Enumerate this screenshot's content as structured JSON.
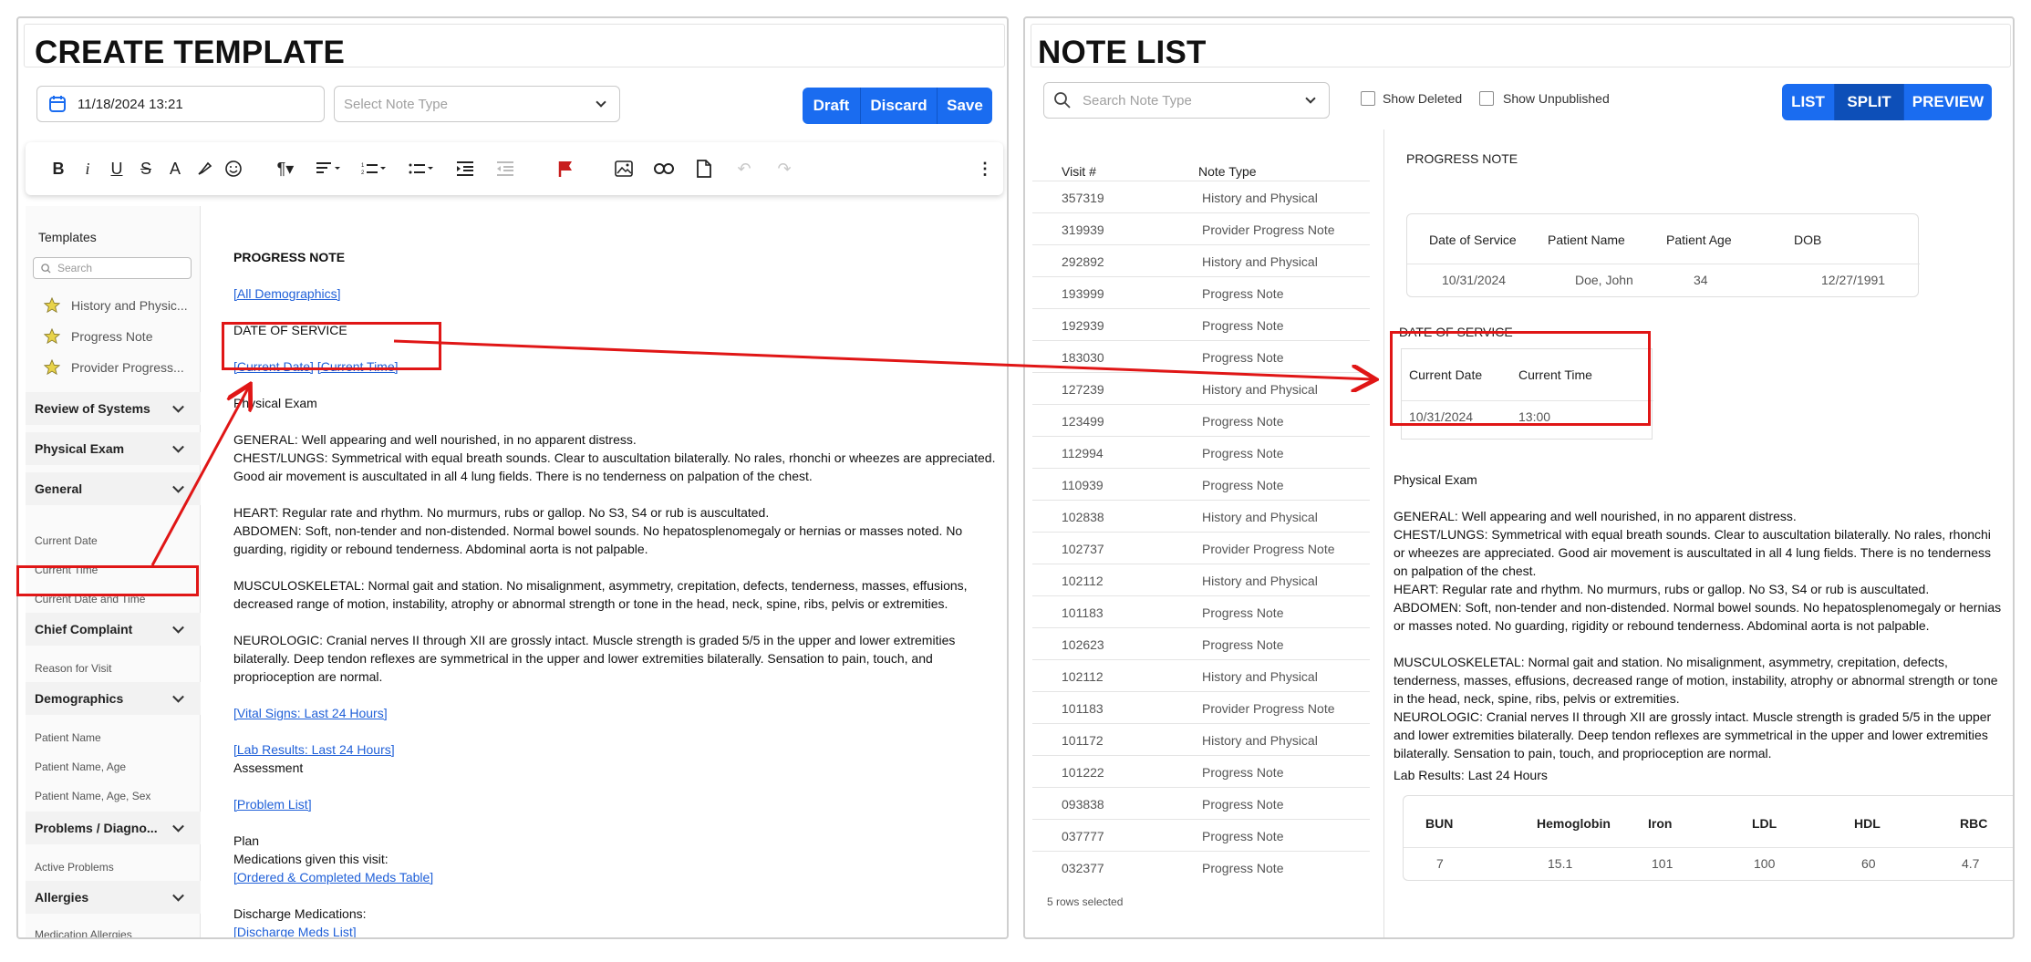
{
  "create_template": {
    "title": "CREATE TEMPLATE",
    "date_value": "11/18/2024 13:21",
    "note_type_placeholder": "Select Note Type",
    "buttons": {
      "draft": "Draft",
      "discard": "Discard",
      "save": "Save"
    },
    "toolbar_icons": [
      "bold-icon",
      "italic-icon",
      "underline-icon",
      "strikethrough-icon",
      "font-color-icon",
      "highlighter-icon",
      "emoji-icon",
      "paragraph-format-icon",
      "align-icon",
      "ordered-list-icon",
      "unordered-list-icon",
      "indent-icon",
      "outdent-icon",
      "flag-icon",
      "image-icon",
      "link-icon",
      "document-icon",
      "undo-icon",
      "redo-icon",
      "more-vertical-icon"
    ],
    "sidebar": {
      "templates_label": "Templates",
      "search_placeholder": "Search",
      "templates": [
        "History and Physic...",
        "Progress Note",
        "Provider Progress..."
      ],
      "sections": [
        {
          "label": "Review of Systems",
          "items": []
        },
        {
          "label": "Physical Exam",
          "items": []
        },
        {
          "label": "General",
          "items": [
            "Current Date",
            "Current Time",
            "Current Date and Time"
          ]
        },
        {
          "label": "Chief Complaint",
          "items": [
            "Reason for Visit"
          ]
        },
        {
          "label": "Demographics",
          "items": [
            "Patient Name",
            "Patient Name, Age",
            "Patient Name, Age, Sex"
          ]
        },
        {
          "label": "Problems / Diagno...",
          "items": [
            "Active Problems"
          ]
        },
        {
          "label": "Allergies",
          "items": [
            "Medication Allergies"
          ]
        }
      ]
    },
    "document": {
      "heading": "PROGRESS NOTE",
      "all_demographics": "[All Demographics]",
      "date_of_service": "DATE OF SERVICE",
      "current_date": "[Current Date]",
      "current_time": "[Current Time]",
      "physical_exam": "Physical Exam",
      "general": "GENERAL: Well appearing and well nourished, in no apparent distress.",
      "chest": "CHEST/LUNGS: Symmetrical with equal breath sounds. Clear to auscultation bilaterally. No rales, rhonchi or wheezes are appreciated. Good air movement is auscultated in all 4 lung fields. There is no tenderness on palpation of the chest.",
      "heart": "HEART: Regular rate and rhythm. No murmurs, rubs or gallop. No S3, S4 or rub is auscultated.",
      "abdomen": "ABDOMEN: Soft, non-tender and non-distended. Normal bowel sounds. No hepatosplenomegaly or hernias or masses noted. No guarding, rigidity or rebound tenderness. Abdominal aorta is not palpable.",
      "musculo": "MUSCULOSKELETAL: Normal gait and station. No misalignment, asymmetry, crepitation, defects, tenderness, masses, effusions, decreased range of motion, instability, atrophy or abnormal strength or tone in the head, neck, spine, ribs, pelvis or extremities.",
      "neuro": "NEUROLOGIC: Cranial nerves II through XII are grossly intact. Muscle strength is graded 5/5 in the upper and lower extremities bilaterally. Deep tendon reflexes are symmetrical in the upper and lower extremities bilaterally. Sensation to pain, touch, and proprioception are normal.",
      "vitals": "[Vital Signs: Last 24 Hours]",
      "labs": "[Lab Results: Last 24 Hours]",
      "assessment": "Assessment",
      "problem_list": "[Problem List]",
      "plan": "Plan",
      "meds_given": "Medications given this visit:",
      "meds_table": "[Ordered & Completed Meds Table]",
      "discharge": "Discharge Medications:",
      "discharge_list": "[Discharge Meds List]"
    }
  },
  "note_list": {
    "title": "NOTE LIST",
    "search_placeholder": "Search Note Type",
    "show_deleted": "Show Deleted",
    "show_unpublished": "Show Unpublished",
    "view_buttons": {
      "list": "LIST",
      "split": "SPLIT",
      "preview": "PREVIEW"
    },
    "columns": {
      "visit": "Visit #",
      "type": "Note Type"
    },
    "rows": [
      {
        "visit": "357319",
        "type": "History and Physical"
      },
      {
        "visit": "319939",
        "type": "Provider Progress Note"
      },
      {
        "visit": "292892",
        "type": "History and Physical"
      },
      {
        "visit": "193999",
        "type": "Progress Note"
      },
      {
        "visit": "192939",
        "type": "Progress Note"
      },
      {
        "visit": "183030",
        "type": "Progress Note"
      },
      {
        "visit": "127239",
        "type": "History and Physical"
      },
      {
        "visit": "123499",
        "type": "Progress Note"
      },
      {
        "visit": "112994",
        "type": "Progress Note"
      },
      {
        "visit": "110939",
        "type": "Progress Note"
      },
      {
        "visit": "102838",
        "type": "History and Physical"
      },
      {
        "visit": "102737",
        "type": "Provider Progress Note"
      },
      {
        "visit": "102112",
        "type": "History and Physical"
      },
      {
        "visit": "101183",
        "type": "Progress Note"
      },
      {
        "visit": "102623",
        "type": "Progress Note"
      },
      {
        "visit": "102112",
        "type": "History and Physical"
      },
      {
        "visit": "101183",
        "type": "Provider Progress Note"
      },
      {
        "visit": "101172",
        "type": "History and Physical"
      },
      {
        "visit": "101222",
        "type": "Progress Note"
      },
      {
        "visit": "093838",
        "type": "Progress Note"
      },
      {
        "visit": "037777",
        "type": "Progress Note"
      },
      {
        "visit": "032377",
        "type": "Progress Note"
      }
    ],
    "rows_selected": "5 rows selected",
    "preview": {
      "heading": "PROGRESS NOTE",
      "demo_headers": [
        "Date of Service",
        "Patient Name",
        "Patient Age",
        "DOB"
      ],
      "demo_values": [
        "10/31/2024",
        "Doe, John",
        "34",
        "12/27/1991"
      ],
      "date_of_service": "DATE OF SERVICE",
      "dt_headers": [
        "Current Date",
        "Current Time"
      ],
      "dt_values": [
        "10/31/2024",
        "13:00"
      ],
      "physical_exam": "Physical Exam",
      "general": "GENERAL: Well appearing and well nourished, in no apparent distress.",
      "chest": "CHEST/LUNGS: Symmetrical with equal breath sounds. Clear to auscultation bilaterally. No rales, rhonchi or wheezes are appreciated. Good air movement is auscultated in all 4 lung fields. There is no tenderness on palpation of the chest.",
      "heart": "HEART: Regular rate and rhythm. No murmurs, rubs or gallop. No S3, S4 or rub is auscultated.",
      "abdomen": "ABDOMEN: Soft, non-tender and non-distended. Normal bowel sounds. No hepatosplenomegaly or hernias or masses noted. No guarding, rigidity or rebound tenderness. Abdominal aorta is not palpable.",
      "musculo": "MUSCULOSKELETAL: Normal gait and station. No misalignment, asymmetry, crepitation, defects, tenderness, masses, effusions, decreased range of motion, instability, atrophy or abnormal strength or tone in the head, neck, spine, ribs, pelvis or extremities.",
      "neuro": "NEUROLOGIC: Cranial nerves II through XII are grossly intact. Muscle strength is graded 5/5 in the upper and lower extremities bilaterally. Deep tendon reflexes are symmetrical in the upper and lower extremities bilaterally. Sensation to pain, touch, and proprioception are normal.",
      "labs_title": "Lab Results: Last 24 Hours",
      "lab_headers": [
        "BUN",
        "Hemoglobin",
        "Iron",
        "LDL",
        "HDL",
        "RBC"
      ],
      "lab_values": [
        "7",
        "15.1",
        "101",
        "100",
        "60",
        "4.7"
      ]
    }
  },
  "colors": {
    "accent": "#1a6cf0",
    "accent_active": "#0d4fb8",
    "annotation": "#e01616",
    "link": "#2060d8"
  }
}
